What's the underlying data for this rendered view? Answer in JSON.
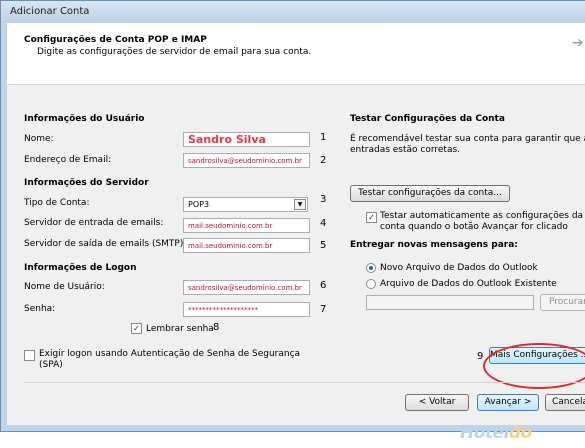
{
  "window": {
    "title": "Adicionar Conta"
  },
  "header": {
    "title": "Configurações de Conta POP e IMAP",
    "subtitle": "Digite as configurações de servidor de email para sua conta."
  },
  "user_info": {
    "section": "Informações do Usuário",
    "name_label": "Nome:",
    "name_value": "Sandro Silva",
    "email_label": "Endereço de Email:",
    "email_value": "sandrosilva@seudominio.com.br"
  },
  "server_info": {
    "section": "Informações do Servidor",
    "account_type_label": "Tipo de Conta:",
    "account_type_value": "POP3",
    "incoming_label": "Servidor de entrada de emails:",
    "incoming_value": "mail.seudominio.com.br",
    "outgoing_label": "Servidor de saída de emails (SMTP):",
    "outgoing_value": "mail.seudominio.com.br"
  },
  "logon_info": {
    "section": "Informações de Logon",
    "username_label": "Nome de Usuário:",
    "username_value": "sandrosilva@seudominio.com.br",
    "password_label": "Senha:",
    "password_value": "********************",
    "remember_label": "Lembrar senha",
    "spa_label": "Exigir logon usando Autenticação de Senha de Segurança",
    "spa_label2": "(SPA)"
  },
  "test_settings": {
    "section": "Testar Configurações da Conta",
    "desc1": "É recomendável testar sua conta para garantir que as",
    "desc2": "entradas estão corretas.",
    "test_button": "Testar configurações da conta...",
    "auto_test1": "Testar automaticamente as configurações da",
    "auto_test2": "conta quando o botão Avançar for clicado"
  },
  "deliver": {
    "section": "Entregar novas mensagens para:",
    "option_new": "Novo Arquivo de Dados do Outlook",
    "option_existing": "Arquivo de Dados do Outlook Existente",
    "browse_button": "Procurar"
  },
  "annotations": [
    "1",
    "2",
    "3",
    "4",
    "5",
    "6",
    "7",
    "8",
    "9"
  ],
  "footer": {
    "more_settings": "Mais Configurações ...",
    "back": "< Voltar",
    "next": "Avançar >",
    "cancel": "Cancelar"
  },
  "watermark": {
    "main": "Hotel",
    "accent": "do"
  }
}
